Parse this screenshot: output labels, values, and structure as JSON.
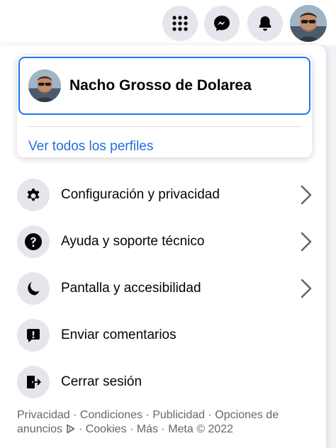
{
  "topbar": {
    "icons": [
      "apps-grid-icon",
      "messenger-icon",
      "bell-icon",
      "avatar"
    ]
  },
  "profile": {
    "name": "Nacho Grosso de Dolarea",
    "see_all": "Ver todos los perfiles"
  },
  "menu": [
    {
      "label": "Configuración y privacidad",
      "icon": "gear-icon",
      "chevron": true
    },
    {
      "label": "Ayuda y soporte técnico",
      "icon": "help-icon",
      "chevron": true
    },
    {
      "label": "Pantalla y accesibilidad",
      "icon": "moon-icon",
      "chevron": true
    },
    {
      "label": "Enviar comentarios",
      "icon": "feedback-icon",
      "chevron": false
    },
    {
      "label": "Cerrar sesión",
      "icon": "logout-icon",
      "chevron": false
    }
  ],
  "footer": {
    "privacy": "Privacidad",
    "terms": "Condiciones",
    "advertising": "Publicidad",
    "ad_choices": "Opciones de anuncios",
    "cookies": "Cookies",
    "more": "Más",
    "meta": "Meta © 2022",
    "sep": " · "
  },
  "colors": {
    "accent": "#1877f2",
    "link": "#216fdb",
    "icon_bg": "#e4e6eb",
    "muted": "#65676b"
  }
}
